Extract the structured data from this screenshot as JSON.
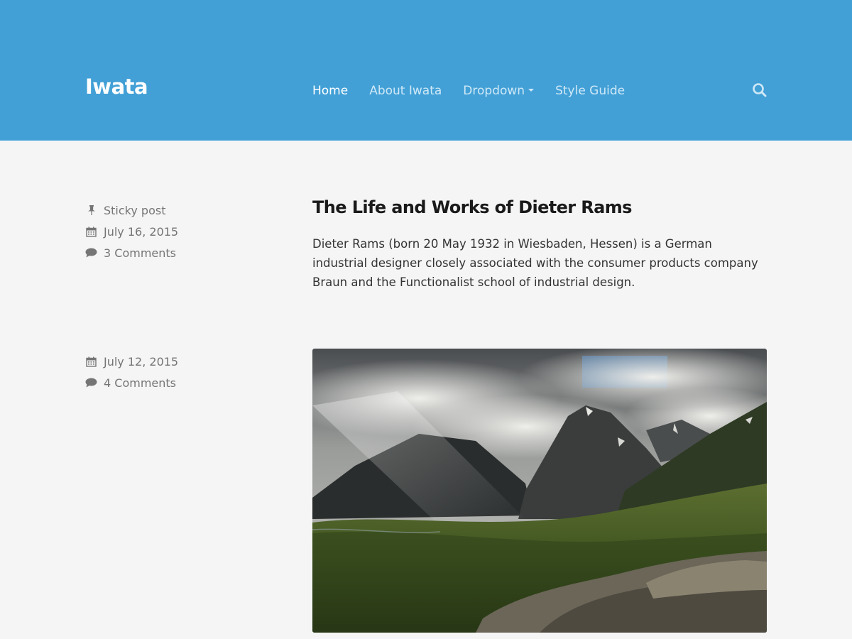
{
  "site": {
    "title": "Iwata"
  },
  "nav": {
    "items": [
      {
        "label": "Home"
      },
      {
        "label": "About Iwata"
      },
      {
        "label": "Dropdown"
      },
      {
        "label": "Style Guide"
      }
    ],
    "active_item": "Home"
  },
  "posts": [
    {
      "sticky_label": "Sticky post",
      "date": "July 16, 2015",
      "comments": "3 Comments",
      "title": "The Life and Works of Dieter Rams",
      "excerpt": "Dieter Rams (born 20 May 1932 in Wiesbaden, Hessen) is a German industrial designer closely associated with the consumer products company Braun and the Functionalist school of industrial design."
    },
    {
      "date": "July 12, 2015",
      "comments": "4 Comments",
      "image": "mountain landscape photo"
    }
  ],
  "icons": {
    "pin": "pin-icon",
    "calendar": "calendar-icon",
    "comment": "comment-icon",
    "search": "search-icon",
    "dropdown": "chevron-down-icon"
  },
  "colors": {
    "header_bg": "#42a0d6",
    "page_bg": "#f5f5f5",
    "nav_text": "#cfe8f7",
    "nav_active": "#ffffff",
    "meta_text": "#757575",
    "title_text": "#1a1a1a"
  }
}
